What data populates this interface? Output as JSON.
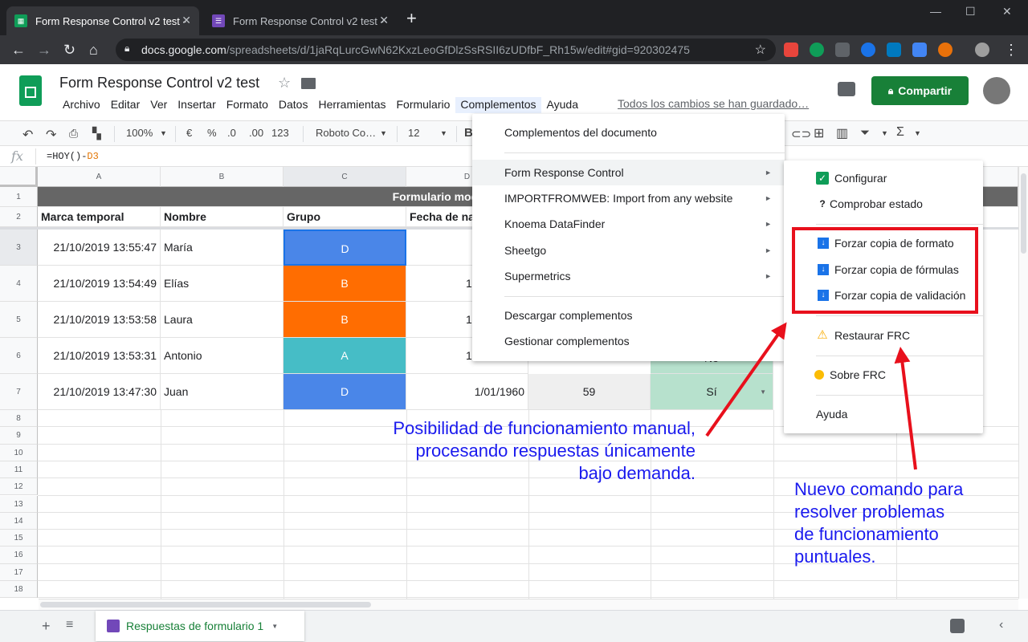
{
  "browser": {
    "tabs": [
      {
        "title": "Form Response Control v2 test -",
        "active": true
      },
      {
        "title": "Form Response Control v2 test -",
        "active": false
      }
    ],
    "new_tab": "+",
    "url_host": "docs.google.com",
    "url_path": "/spreadsheets/d/1jaRqLurcGwN62KxzLeoGfDlzSsRSII6zUDfbF_Rh15w/edit#gid=920302475"
  },
  "sheets": {
    "title": "Form Response Control v2 test",
    "menu": [
      "Archivo",
      "Editar",
      "Ver",
      "Insertar",
      "Formato",
      "Datos",
      "Herramientas",
      "Formulario",
      "Complementos",
      "Ayuda"
    ],
    "saved_status": "Todos los cambios se han guardado…",
    "share_label": "Compartir",
    "toolbar": {
      "zoom": "100%",
      "currency": "€",
      "percent": "%",
      "dec_less": ".0",
      "dec_more": ".00",
      "format": "123",
      "font": "Roboto Co…",
      "size": "12",
      "bold": "B"
    },
    "formula_fx": "fx",
    "formula_prefix": "=HOY()-",
    "formula_ref": "D3"
  },
  "grid": {
    "columns": [
      "A",
      "B",
      "C",
      "D"
    ],
    "row_numbers": [
      "1",
      "2",
      "3",
      "4",
      "5",
      "6",
      "7",
      "8",
      "9",
      "10",
      "11",
      "12",
      "13",
      "14",
      "15",
      "16",
      "17",
      "18"
    ],
    "banner": "Formulario modelo",
    "headers": [
      "Marca temporal",
      "Nombre",
      "Grupo",
      "Fecha de nac"
    ],
    "rows": [
      {
        "timestamp": "21/10/2019 13:55:47",
        "name": "María",
        "group": "D",
        "date": "",
        "group_color": "#4a86e8"
      },
      {
        "timestamp": "21/10/2019 13:54:49",
        "name": "Elías",
        "group": "B",
        "date": "1",
        "group_color": "#ff6d01"
      },
      {
        "timestamp": "21/10/2019 13:53:58",
        "name": "Laura",
        "group": "B",
        "date": "1",
        "group_color": "#ff6d01"
      },
      {
        "timestamp": "21/10/2019 13:53:31",
        "name": "Antonio",
        "group": "A",
        "date": "1",
        "group_color": "#46bdc6",
        "extra": "No"
      },
      {
        "timestamp": "21/10/2019 13:47:30",
        "name": "Juan",
        "group": "D",
        "date": "1/01/1960",
        "group_color": "#4a86e8",
        "age": "59",
        "answer": "Sí"
      }
    ]
  },
  "addons_menu": {
    "items": [
      "Complementos del documento",
      "Form Response Control",
      "IMPORTFROMWEB: Import from any website",
      "Knoema DataFinder",
      "Sheetgo",
      "Supermetrics",
      "Descargar complementos",
      "Gestionar complementos"
    ],
    "arrow": "►"
  },
  "frc_submenu": {
    "items": [
      "Configurar",
      "Comprobar estado",
      "Forzar copia de formato",
      "Forzar copia de fórmulas",
      "Forzar copia de validación",
      "Restaurar FRC",
      "Sobre FRC",
      "Ayuda"
    ]
  },
  "annotations": {
    "left_lines": [
      "Posibilidad de funcionamiento manual,",
      "procesando respuestas únicamente",
      "bajo demanda."
    ],
    "right_lines": [
      "Nuevo comando para",
      "resolver problemas",
      "de funcionamiento",
      "puntuales."
    ]
  },
  "sheet_tab": {
    "label": "Respuestas de formulario 1"
  },
  "colors": {
    "accent_green": "#188038",
    "annotation_blue": "#1a1aee",
    "annotation_red": "#e8101c"
  }
}
